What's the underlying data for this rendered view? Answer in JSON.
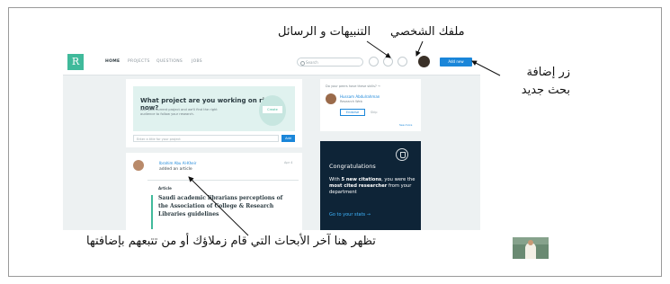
{
  "callouts": {
    "profile": "ملفك الشخصي",
    "notifications": "التنبيهات و الرسائل",
    "add_research": "زر إضافة بحث جديد",
    "latest_research": "تظهر هنا آخر الأبحاث التي قام زملاؤك أو من تتبعهم بإضافتها"
  },
  "app": {
    "logo": "R",
    "nav": [
      "HOME",
      "PROJECTS",
      "QUESTIONS",
      "JOBS"
    ],
    "search_placeholder": "Search",
    "add_button": "Add new"
  },
  "project_card": {
    "title": "What project are you working on right now?",
    "subtitle": "Add your current project and we'll find the right audience to follow your research.",
    "create_button": "Create",
    "input_placeholder": "Enter a title for your project",
    "add_button": "Add"
  },
  "feed": {
    "author": "Ibrahim Abu Al-Kheir",
    "action": "added an article",
    "time": "Apr 4",
    "article_label": "Article",
    "article_title": "Saudi academic librarians perceptions of the Association of College & Research Libraries guidelines"
  },
  "follow_card": {
    "question": "Do your peers have these skills? →",
    "person_name": "Hussam Abdulrahman",
    "institution": "Research Web",
    "endorse_button": "Endorse",
    "skip": "Skip",
    "see_more": "See more"
  },
  "congrats_card": {
    "title": "Congratulations",
    "body_prefix": "With ",
    "body_highlight1": "5 new citations",
    "body_mid": ", you were the ",
    "body_highlight2": "most cited researcher",
    "body_suffix": " from your department",
    "link": "Go to your stats →"
  },
  "icons": {
    "search": "search-icon",
    "notifications": "bell-icon",
    "messages": "message-icon",
    "help": "question-icon",
    "trophy": "trophy-icon"
  },
  "colors": {
    "accent_green": "#40ba9b",
    "primary_blue": "#1a86d9",
    "congrats_navy": "#0e2437"
  }
}
